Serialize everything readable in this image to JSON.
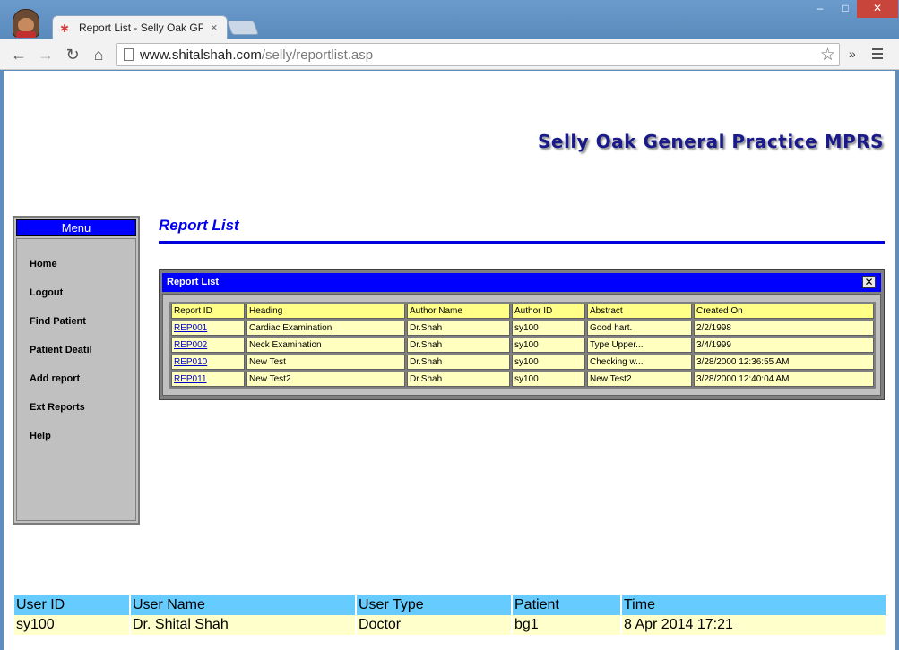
{
  "browser": {
    "tab_title": "Report List - Selly Oak GP",
    "tab_close": "×",
    "url_host": "www.shitalshah.com",
    "url_path": "/selly/reportlist.asp",
    "window_controls": {
      "minimize": "–",
      "maximize": "□",
      "close": "✕"
    },
    "extensions_chevron": "»"
  },
  "site": {
    "title": "Selly Oak General Practice MPRS"
  },
  "menu": {
    "header": "Menu",
    "items": [
      "Home",
      "Logout",
      "Find Patient",
      "Patient Deatil",
      "Add report",
      "Ext Reports",
      "Help"
    ]
  },
  "page": {
    "heading": "Report List"
  },
  "report_window": {
    "title": "Report List",
    "close": "✕",
    "columns": [
      "Report ID",
      "Heading",
      "Author Name",
      "Author ID",
      "Abstract",
      "Created On"
    ],
    "rows": [
      [
        "REP001",
        "Cardiac Examination",
        "Dr.Shah",
        "sy100",
        "Good hart.",
        "2/2/1998"
      ],
      [
        "REP002",
        "Neck Examination",
        "Dr.Shah",
        "sy100",
        "Type Upper...",
        "3/4/1999"
      ],
      [
        "REP010",
        "New Test",
        "Dr.Shah",
        "sy100",
        "Checking w...",
        "3/28/2000 12:36:55 AM"
      ],
      [
        "REP011",
        "New Test2",
        "Dr.Shah",
        "sy100",
        "New Test2",
        "3/28/2000 12:40:04 AM"
      ]
    ]
  },
  "footer": {
    "headers": [
      "User ID",
      "User Name",
      "User Type",
      "Patient",
      "Time"
    ],
    "values": [
      "sy100",
      "Dr. Shital Shah",
      "Doctor",
      "bg1",
      "8 Apr 2014 17:21"
    ]
  },
  "colors": {
    "menu_header": "#0000ff",
    "menu_bg": "#c0c0c0",
    "title_text": "#1a1a8a",
    "heading": "#0000ee",
    "table_header": "#ffff88",
    "table_cell": "#ffffc0",
    "footer_header": "#66ccff",
    "footer_value": "#ffffcc"
  }
}
